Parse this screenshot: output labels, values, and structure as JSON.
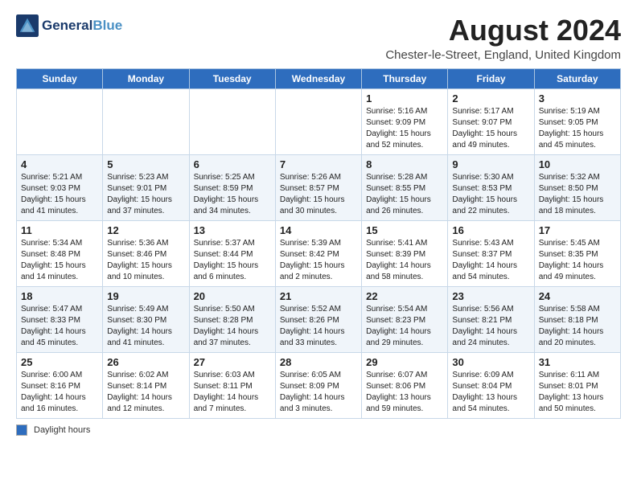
{
  "header": {
    "logo_line1": "General",
    "logo_line2": "Blue",
    "title": "August 2024",
    "subtitle": "Chester-le-Street, England, United Kingdom"
  },
  "footer": {
    "legend_label": "Daylight hours"
  },
  "weekdays": [
    "Sunday",
    "Monday",
    "Tuesday",
    "Wednesday",
    "Thursday",
    "Friday",
    "Saturday"
  ],
  "weeks": [
    [
      {
        "day": "",
        "info": ""
      },
      {
        "day": "",
        "info": ""
      },
      {
        "day": "",
        "info": ""
      },
      {
        "day": "",
        "info": ""
      },
      {
        "day": "1",
        "info": "Sunrise: 5:16 AM\nSunset: 9:09 PM\nDaylight: 15 hours\nand 52 minutes."
      },
      {
        "day": "2",
        "info": "Sunrise: 5:17 AM\nSunset: 9:07 PM\nDaylight: 15 hours\nand 49 minutes."
      },
      {
        "day": "3",
        "info": "Sunrise: 5:19 AM\nSunset: 9:05 PM\nDaylight: 15 hours\nand 45 minutes."
      }
    ],
    [
      {
        "day": "4",
        "info": "Sunrise: 5:21 AM\nSunset: 9:03 PM\nDaylight: 15 hours\nand 41 minutes."
      },
      {
        "day": "5",
        "info": "Sunrise: 5:23 AM\nSunset: 9:01 PM\nDaylight: 15 hours\nand 37 minutes."
      },
      {
        "day": "6",
        "info": "Sunrise: 5:25 AM\nSunset: 8:59 PM\nDaylight: 15 hours\nand 34 minutes."
      },
      {
        "day": "7",
        "info": "Sunrise: 5:26 AM\nSunset: 8:57 PM\nDaylight: 15 hours\nand 30 minutes."
      },
      {
        "day": "8",
        "info": "Sunrise: 5:28 AM\nSunset: 8:55 PM\nDaylight: 15 hours\nand 26 minutes."
      },
      {
        "day": "9",
        "info": "Sunrise: 5:30 AM\nSunset: 8:53 PM\nDaylight: 15 hours\nand 22 minutes."
      },
      {
        "day": "10",
        "info": "Sunrise: 5:32 AM\nSunset: 8:50 PM\nDaylight: 15 hours\nand 18 minutes."
      }
    ],
    [
      {
        "day": "11",
        "info": "Sunrise: 5:34 AM\nSunset: 8:48 PM\nDaylight: 15 hours\nand 14 minutes."
      },
      {
        "day": "12",
        "info": "Sunrise: 5:36 AM\nSunset: 8:46 PM\nDaylight: 15 hours\nand 10 minutes."
      },
      {
        "day": "13",
        "info": "Sunrise: 5:37 AM\nSunset: 8:44 PM\nDaylight: 15 hours\nand 6 minutes."
      },
      {
        "day": "14",
        "info": "Sunrise: 5:39 AM\nSunset: 8:42 PM\nDaylight: 15 hours\nand 2 minutes."
      },
      {
        "day": "15",
        "info": "Sunrise: 5:41 AM\nSunset: 8:39 PM\nDaylight: 14 hours\nand 58 minutes."
      },
      {
        "day": "16",
        "info": "Sunrise: 5:43 AM\nSunset: 8:37 PM\nDaylight: 14 hours\nand 54 minutes."
      },
      {
        "day": "17",
        "info": "Sunrise: 5:45 AM\nSunset: 8:35 PM\nDaylight: 14 hours\nand 49 minutes."
      }
    ],
    [
      {
        "day": "18",
        "info": "Sunrise: 5:47 AM\nSunset: 8:33 PM\nDaylight: 14 hours\nand 45 minutes."
      },
      {
        "day": "19",
        "info": "Sunrise: 5:49 AM\nSunset: 8:30 PM\nDaylight: 14 hours\nand 41 minutes."
      },
      {
        "day": "20",
        "info": "Sunrise: 5:50 AM\nSunset: 8:28 PM\nDaylight: 14 hours\nand 37 minutes."
      },
      {
        "day": "21",
        "info": "Sunrise: 5:52 AM\nSunset: 8:26 PM\nDaylight: 14 hours\nand 33 minutes."
      },
      {
        "day": "22",
        "info": "Sunrise: 5:54 AM\nSunset: 8:23 PM\nDaylight: 14 hours\nand 29 minutes."
      },
      {
        "day": "23",
        "info": "Sunrise: 5:56 AM\nSunset: 8:21 PM\nDaylight: 14 hours\nand 24 minutes."
      },
      {
        "day": "24",
        "info": "Sunrise: 5:58 AM\nSunset: 8:18 PM\nDaylight: 14 hours\nand 20 minutes."
      }
    ],
    [
      {
        "day": "25",
        "info": "Sunrise: 6:00 AM\nSunset: 8:16 PM\nDaylight: 14 hours\nand 16 minutes."
      },
      {
        "day": "26",
        "info": "Sunrise: 6:02 AM\nSunset: 8:14 PM\nDaylight: 14 hours\nand 12 minutes."
      },
      {
        "day": "27",
        "info": "Sunrise: 6:03 AM\nSunset: 8:11 PM\nDaylight: 14 hours\nand 7 minutes."
      },
      {
        "day": "28",
        "info": "Sunrise: 6:05 AM\nSunset: 8:09 PM\nDaylight: 14 hours\nand 3 minutes."
      },
      {
        "day": "29",
        "info": "Sunrise: 6:07 AM\nSunset: 8:06 PM\nDaylight: 13 hours\nand 59 minutes."
      },
      {
        "day": "30",
        "info": "Sunrise: 6:09 AM\nSunset: 8:04 PM\nDaylight: 13 hours\nand 54 minutes."
      },
      {
        "day": "31",
        "info": "Sunrise: 6:11 AM\nSunset: 8:01 PM\nDaylight: 13 hours\nand 50 minutes."
      }
    ]
  ]
}
